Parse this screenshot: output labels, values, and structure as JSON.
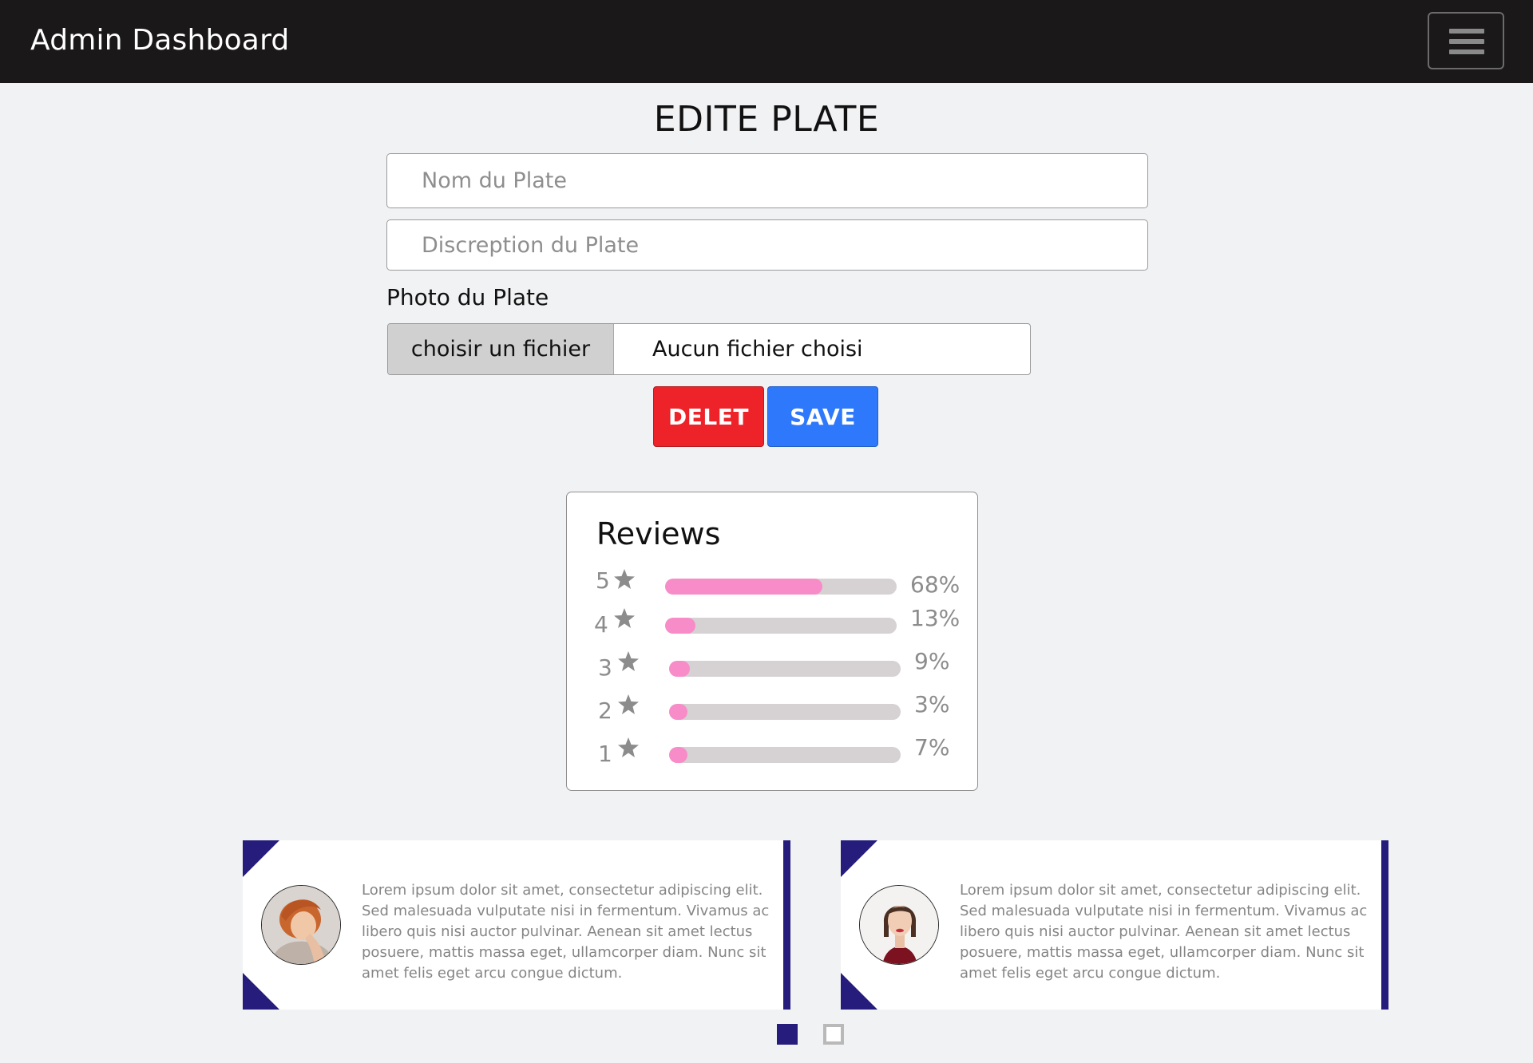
{
  "navbar": {
    "brand": "Admin Dashboard",
    "menu_icon": "hamburger-menu-icon"
  },
  "form": {
    "title": "EDITE PLATE",
    "name_placeholder": "Nom du Plate",
    "description_placeholder": "Discreption du Plate",
    "photo_label": "Photo du Plate",
    "file_button_label": "choisir un fichier",
    "file_status": "Aucun fichier choisi",
    "delete_label": "DELET",
    "save_label": "SAVE"
  },
  "colors": {
    "navbar_bg": "#1a1819",
    "delete": "#ee2229",
    "save": "#2e78fb",
    "bar_fill": "#f78cc8",
    "bar_track": "#d6d2d3",
    "testimonial_accent": "#251c7c"
  },
  "reviews": {
    "title": "Reviews",
    "star_icon": "star-icon",
    "ratings": [
      {
        "stars": "5",
        "percent": 68,
        "label": "68%"
      },
      {
        "stars": "4",
        "percent": 13,
        "label": "13%"
      },
      {
        "stars": "3",
        "percent": 9,
        "label": "9%"
      },
      {
        "stars": "2",
        "percent": 3,
        "label": "3%"
      },
      {
        "stars": "1",
        "percent": 7,
        "label": "7%"
      }
    ]
  },
  "testimonials": [
    {
      "avatar_icon": "avatar-red-hair-woman",
      "text": "Lorem ipsum dolor sit amet, consectetur adipiscing elit. Sed malesuada vulputate nisi in fermentum. Vivamus ac libero quis nisi auctor pulvinar. Aenean sit amet lectus posuere, mattis massa eget, ullamcorper diam. Nunc sit amet felis eget arcu congue dictum."
    },
    {
      "avatar_icon": "avatar-dark-hair-woman",
      "text": "Lorem ipsum dolor sit amet, consectetur adipiscing elit. Sed malesuada vulputate nisi in fermentum. Vivamus ac libero quis nisi auctor pulvinar. Aenean sit amet lectus posuere, mattis massa eget, ullamcorper diam. Nunc sit amet felis eget arcu congue dictum."
    }
  ],
  "carousel": {
    "active_index": 0,
    "count": 2
  }
}
